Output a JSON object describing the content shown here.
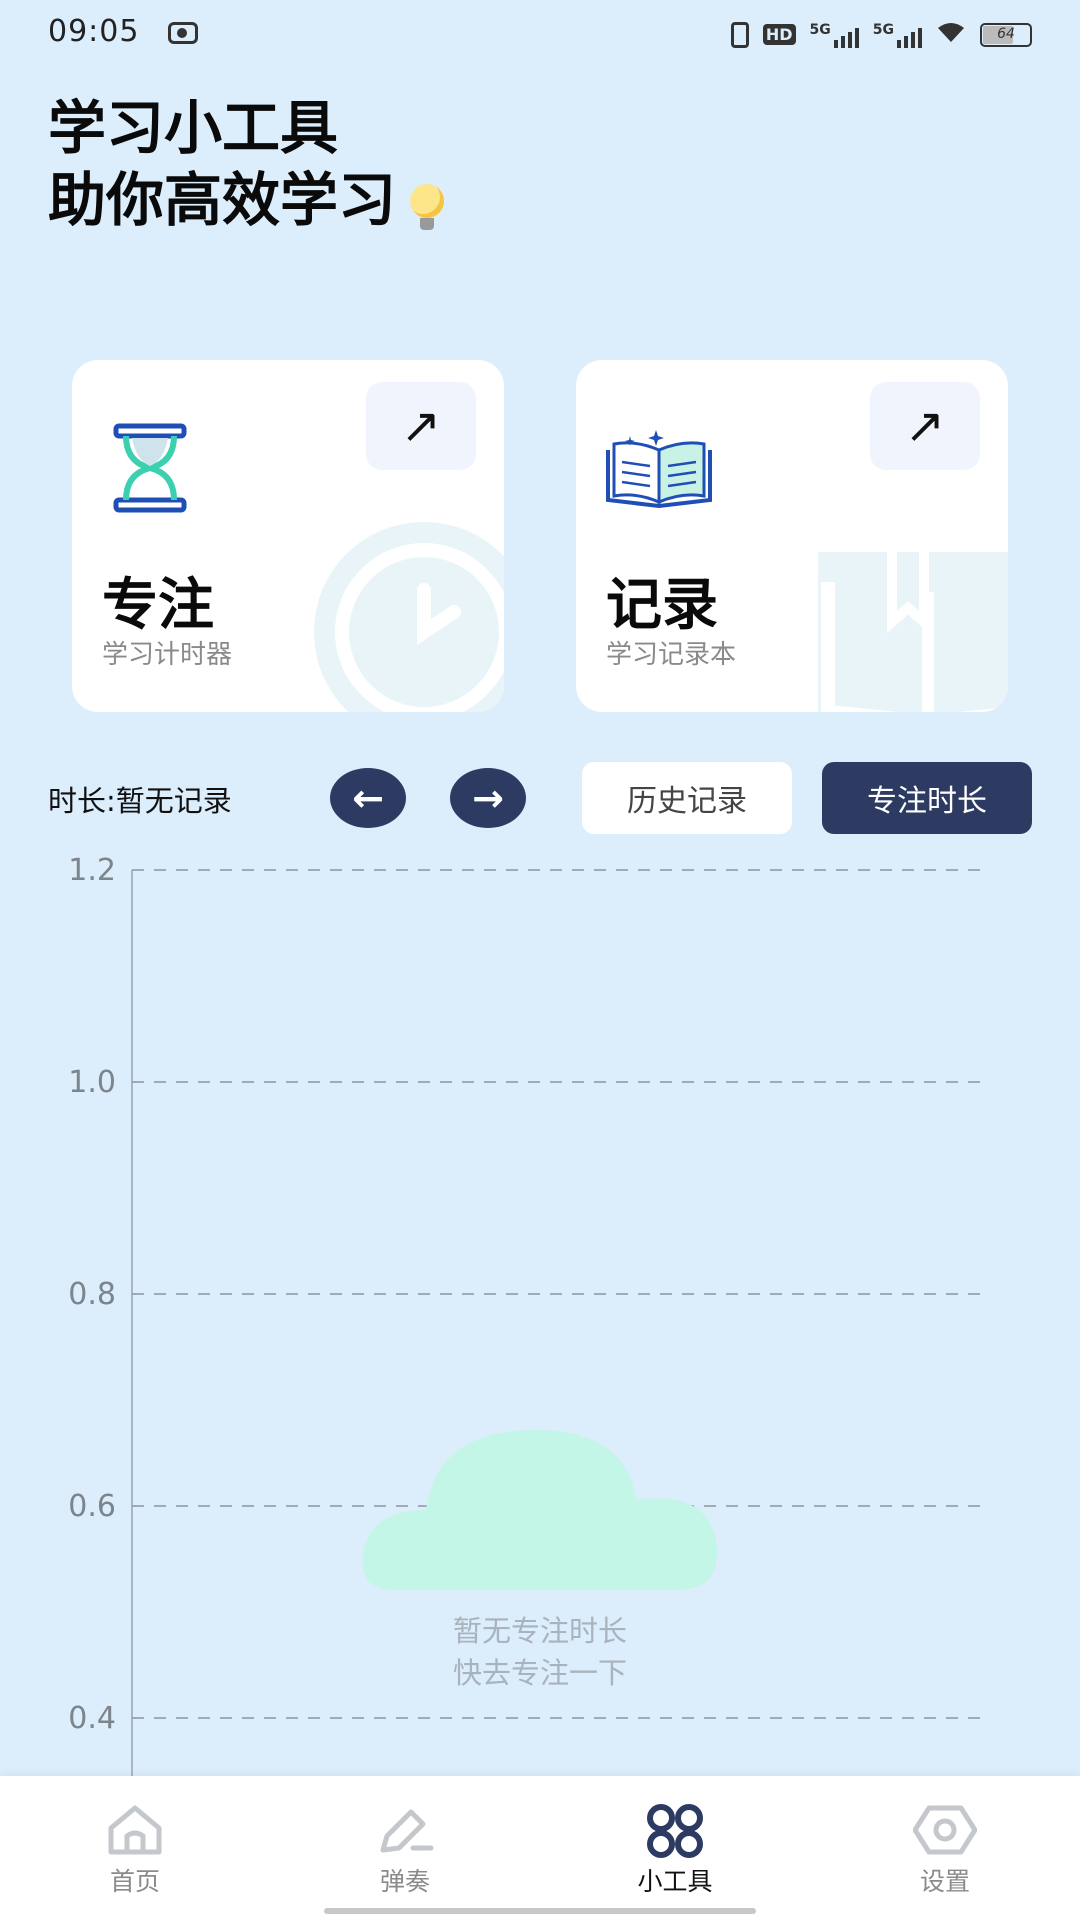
{
  "status_bar": {
    "time": "09:05",
    "hd_label": "HD",
    "network_1": "5G",
    "network_2": "5G",
    "battery": "64"
  },
  "header": {
    "line1": "学习小工具",
    "line2": "助你高效学习"
  },
  "cards": [
    {
      "title": "专注",
      "subtitle": "学习计时器",
      "arrow": "↗",
      "icon": "hourglass-icon"
    },
    {
      "title": "记录",
      "subtitle": "学习记录本",
      "arrow": "↗",
      "icon": "open-book-icon"
    }
  ],
  "controls": {
    "duration_label": "时长:暂无记录",
    "prev": "←",
    "next": "→",
    "history_label": "历史记录",
    "focus_duration_label": "专注时长"
  },
  "chart_data": {
    "type": "line",
    "y_ticks": [
      "1.2",
      "1.0",
      "0.8",
      "0.6",
      "0.4"
    ],
    "ylim": [
      0.4,
      1.2
    ],
    "grid": true,
    "series": [],
    "empty_message": [
      "暂无专注时长",
      "快去专注一下"
    ]
  },
  "bottom_nav": [
    {
      "label": "首页",
      "icon": "home-icon",
      "active": false
    },
    {
      "label": "弹奏",
      "icon": "pen-icon",
      "active": false
    },
    {
      "label": "小工具",
      "icon": "tools-grid-icon",
      "active": true
    },
    {
      "label": "设置",
      "icon": "settings-hexagon-icon",
      "active": false
    }
  ],
  "colors": {
    "background": "#dcedfc",
    "accent_dark": "#2d3b63",
    "icon_teal": "#3ad0b0",
    "icon_blue": "#1f4fb5"
  }
}
